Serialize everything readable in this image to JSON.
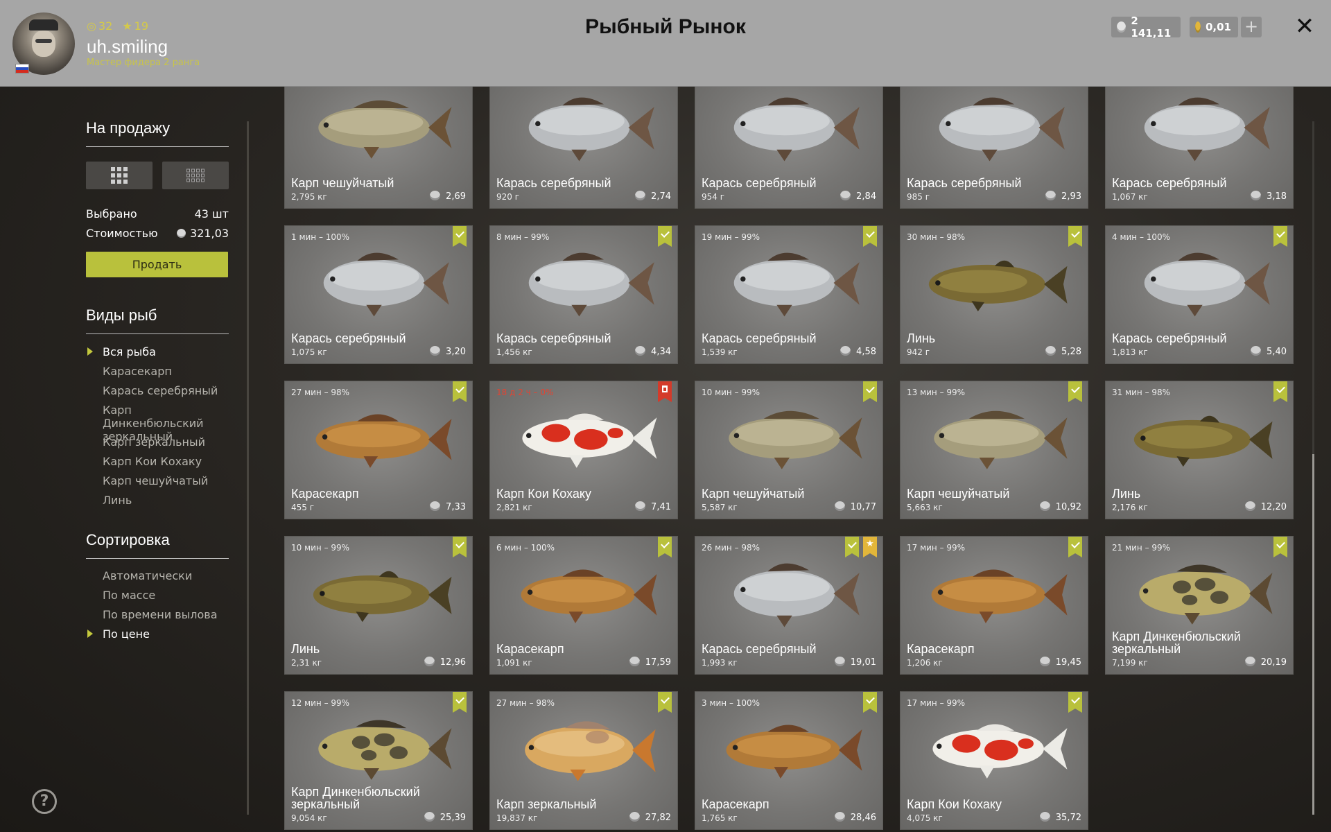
{
  "header": {
    "level": "32",
    "stars": "19",
    "username": "uh.smiling",
    "rank": "Мастер фидера 2 ранга",
    "title": "Рыбный Рынок",
    "silver": "2 141,11",
    "gold": "0,01",
    "plus": "+",
    "close": "✕"
  },
  "sidebar": {
    "sale_title": "На продажу",
    "selected_label": "Выбрано",
    "selected_value": "43 шт",
    "cost_label": "Стоимостью",
    "cost_value": "321,03",
    "sell_button": "Продать",
    "species_title": "Виды рыб",
    "species": [
      "Вся рыба",
      "Карасекарп",
      "Карась серебряный",
      "Карп Динкенбюльский зеркальный",
      "Карп зеркальный",
      "Карп Кои Кохаку",
      "Карп чешуйчатый",
      "Линь"
    ],
    "sort_title": "Сортировка",
    "sort": [
      "Автоматически",
      "По массе",
      "По времени вылова",
      "По цене"
    ],
    "help": "?"
  },
  "colors": {
    "accent": "#b9c13c",
    "expired": "#e04534",
    "gold": "#e2b63a"
  },
  "cards": [
    {
      "time": "",
      "name": "Карп чешуйчатый",
      "weight": "2,795 кг",
      "price": "2,69",
      "fish": "common-carp",
      "badges": []
    },
    {
      "time": "",
      "name": "Карась серебряный",
      "weight": "920 г",
      "price": "2,74",
      "fish": "crucian",
      "badges": []
    },
    {
      "time": "",
      "name": "Карась серебряный",
      "weight": "954 г",
      "price": "2,84",
      "fish": "crucian",
      "badges": []
    },
    {
      "time": "",
      "name": "Карась серебряный",
      "weight": "985 г",
      "price": "2,93",
      "fish": "crucian",
      "badges": []
    },
    {
      "time": "",
      "name": "Карась серебряный",
      "weight": "1,067 кг",
      "price": "3,18",
      "fish": "crucian",
      "badges": []
    },
    {
      "time": "1 мин – 100%",
      "name": "Карась серебряный",
      "weight": "1,075 кг",
      "price": "3,20",
      "fish": "crucian",
      "badges": [
        "check"
      ]
    },
    {
      "time": "8 мин – 99%",
      "name": "Карась серебряный",
      "weight": "1,456 кг",
      "price": "4,34",
      "fish": "crucian",
      "badges": [
        "check"
      ]
    },
    {
      "time": "19 мин – 99%",
      "name": "Карась серебряный",
      "weight": "1,539 кг",
      "price": "4,58",
      "fish": "crucian",
      "badges": [
        "check"
      ]
    },
    {
      "time": "30 мин – 98%",
      "name": "Линь",
      "weight": "942 г",
      "price": "5,28",
      "fish": "tench",
      "badges": [
        "check"
      ]
    },
    {
      "time": "4 мин – 100%",
      "name": "Карась серебряный",
      "weight": "1,813 кг",
      "price": "5,40",
      "fish": "crucian",
      "badges": [
        "check"
      ]
    },
    {
      "time": "27 мин – 98%",
      "name": "Карасекарп",
      "weight": "455 г",
      "price": "7,33",
      "fish": "hybrid",
      "badges": [
        "check"
      ]
    },
    {
      "time": "18 д 2 ч – 0%",
      "expired": true,
      "name": "Карп Кои Кохаку",
      "weight": "2,821 кг",
      "price": "7,41",
      "fish": "koi",
      "badges": [
        "trash"
      ]
    },
    {
      "time": "10 мин – 99%",
      "name": "Карп чешуйчатый",
      "weight": "5,587 кг",
      "price": "10,77",
      "fish": "common-carp",
      "badges": [
        "check"
      ]
    },
    {
      "time": "13 мин – 99%",
      "name": "Карп чешуйчатый",
      "weight": "5,663 кг",
      "price": "10,92",
      "fish": "common-carp",
      "badges": [
        "check"
      ]
    },
    {
      "time": "31 мин – 98%",
      "name": "Линь",
      "weight": "2,176 кг",
      "price": "12,20",
      "fish": "tench",
      "badges": [
        "check"
      ]
    },
    {
      "time": "10 мин – 99%",
      "name": "Линь",
      "weight": "2,31 кг",
      "price": "12,96",
      "fish": "tench",
      "badges": [
        "check"
      ]
    },
    {
      "time": "6 мин – 100%",
      "name": "Карасекарп",
      "weight": "1,091 кг",
      "price": "17,59",
      "fish": "hybrid",
      "badges": [
        "check"
      ]
    },
    {
      "time": "26 мин – 98%",
      "name": "Карась серебряный",
      "weight": "1,993 кг",
      "price": "19,01",
      "fish": "crucian",
      "badges": [
        "check",
        "star"
      ]
    },
    {
      "time": "17 мин – 99%",
      "name": "Карасекарп",
      "weight": "1,206 кг",
      "price": "19,45",
      "fish": "hybrid",
      "badges": [
        "check"
      ]
    },
    {
      "time": "21 мин – 99%",
      "name": "Карп Динкенбюльский зеркальный",
      "weight": "7,199 кг",
      "price": "20,19",
      "fish": "mirror-carp",
      "badges": [
        "check"
      ]
    },
    {
      "time": "12 мин – 99%",
      "name": "Карп Динкенбюльский зеркальный",
      "weight": "9,054 кг",
      "price": "25,39",
      "fish": "mirror-carp",
      "badges": [
        "check"
      ]
    },
    {
      "time": "27 мин – 98%",
      "name": "Карп зеркальный",
      "weight": "19,837 кг",
      "price": "27,82",
      "fish": "mirror-carp-pale",
      "badges": [
        "check"
      ]
    },
    {
      "time": "3 мин – 100%",
      "name": "Карасекарп",
      "weight": "1,765 кг",
      "price": "28,46",
      "fish": "hybrid",
      "badges": [
        "check"
      ]
    },
    {
      "time": "17 мин – 99%",
      "name": "Карп Кои Кохаку",
      "weight": "4,075 кг",
      "price": "35,72",
      "fish": "koi",
      "badges": [
        "check"
      ]
    }
  ]
}
